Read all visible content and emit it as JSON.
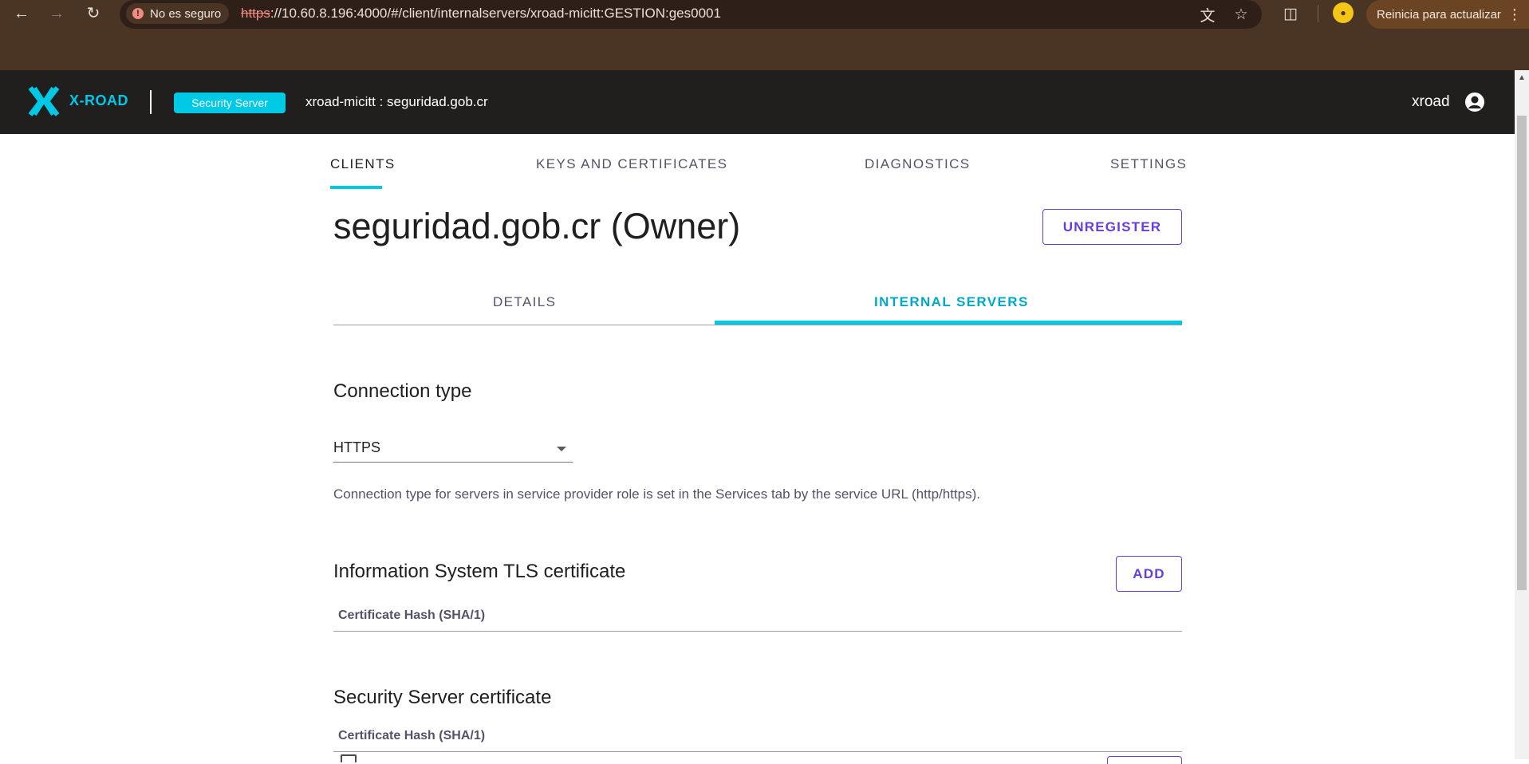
{
  "browser": {
    "security_label": "No es seguro",
    "url_scheme": "https",
    "url_rest": "://10.60.8.196:4000/#/client/internalservers/xroad-micitt:GESTION:ges0001",
    "update_label": "Reinicia para actualizar",
    "back_icon": "arrow-left-icon",
    "forward_icon": "arrow-right-icon",
    "reload_icon": "reload-icon",
    "translate_icon": "translate-icon",
    "bookmark_icon": "star-icon",
    "extensions_icon": "puzzle-icon",
    "menu_icon": "kebab-menu-icon"
  },
  "header": {
    "logo_text": "X-ROAD",
    "badge": "Security Server",
    "server_name": "xroad-micitt : seguridad.gob.cr",
    "username": "xroad",
    "accent_color": "#00c9e6",
    "background_color": "#211e1e"
  },
  "main_tabs": [
    {
      "label": "CLIENTS",
      "active": true
    },
    {
      "label": "KEYS AND CERTIFICATES",
      "active": false
    },
    {
      "label": "DIAGNOSTICS",
      "active": false
    },
    {
      "label": "SETTINGS",
      "active": false
    }
  ],
  "client": {
    "title": "seguridad.gob.cr (Owner)",
    "unregister_label": "UNREGISTER"
  },
  "sub_tabs": [
    {
      "label": "DETAILS",
      "active": false
    },
    {
      "label": "INTERNAL SERVERS",
      "active": true
    }
  ],
  "connection": {
    "heading": "Connection type",
    "selected": "HTTPS",
    "helper": "Connection type for servers in service provider role is set in the Services tab by the service URL (http/https)."
  },
  "tls_section": {
    "heading": "Information System TLS certificate",
    "add_label": "ADD",
    "column_header": "Certificate Hash (SHA/1)"
  },
  "ss_section": {
    "heading": "Security Server certificate",
    "column_header": "Certificate Hash (SHA/1)"
  },
  "colors": {
    "primary_button": "#663cdc",
    "tab_accent": "#00c9e6"
  }
}
